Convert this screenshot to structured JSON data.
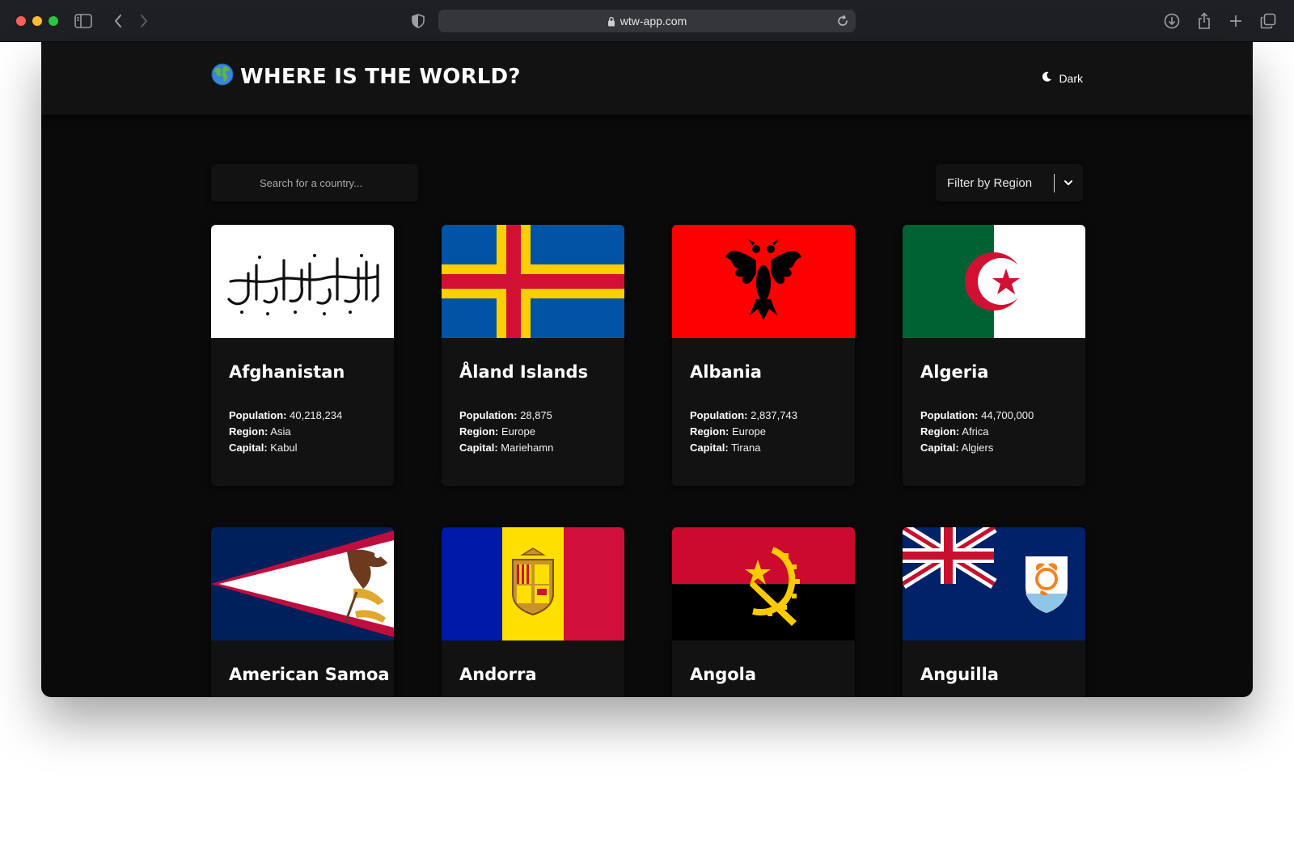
{
  "browser": {
    "url": "wtw-app.com"
  },
  "header": {
    "logo_emoji": "🌍",
    "title": "WHERE IS THE WORLD?",
    "theme_label": "Dark"
  },
  "controls": {
    "search_placeholder": "Search for a country...",
    "filter_label": "Filter by Region"
  },
  "labels": {
    "population": "Population:",
    "region": "Region:",
    "capital": "Capital:"
  },
  "countries": [
    {
      "name": "Afghanistan",
      "population": "40,218,234",
      "region": "Asia",
      "capital": "Kabul",
      "flag": "afghanistan-flag"
    },
    {
      "name": "Åland Islands",
      "population": "28,875",
      "region": "Europe",
      "capital": "Mariehamn",
      "flag": "aland-flag"
    },
    {
      "name": "Albania",
      "population": "2,837,743",
      "region": "Europe",
      "capital": "Tirana",
      "flag": "albania-flag"
    },
    {
      "name": "Algeria",
      "population": "44,700,000",
      "region": "Africa",
      "capital": "Algiers",
      "flag": "algeria-flag"
    },
    {
      "name": "American Samoa",
      "flag": "american-samoa-flag"
    },
    {
      "name": "Andorra",
      "flag": "andorra-flag"
    },
    {
      "name": "Angola",
      "flag": "angola-flag"
    },
    {
      "name": "Anguilla",
      "flag": "anguilla-flag"
    }
  ],
  "colors": {
    "background": "#0a0a0a",
    "surface": "#121212",
    "text": "#ffffff"
  }
}
